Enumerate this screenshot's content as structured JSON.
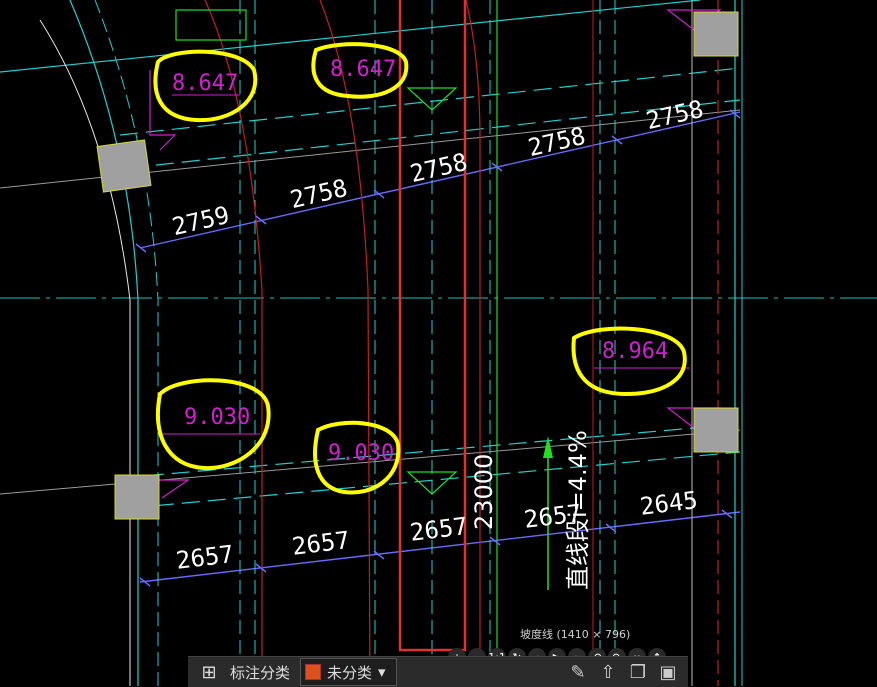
{
  "drawing": {
    "dimensions_top": [
      "2759",
      "2758",
      "2758",
      "2758",
      "2758"
    ],
    "dimensions_bottom": [
      "2657",
      "2657",
      "2657",
      "2657",
      "2645"
    ],
    "elevations": [
      "8.647",
      "8.647",
      "8.964",
      "9.030",
      "9.030"
    ],
    "vertical_label_1": "23000",
    "vertical_label_2": "直线段i=4.4%",
    "colors": {
      "cyan": "#20d0d0",
      "red": "#e03030",
      "blue": "#6a6aff",
      "green": "#20e020",
      "magenta": "#d020d0",
      "highlight": "#ffff00"
    }
  },
  "viewer": {
    "caption": "坡度线 (1410 × 796)",
    "controls": [
      "+",
      "−",
      "1:1",
      "↻",
      "‹",
      "▶",
      "›",
      "↶",
      "↷",
      "↔",
      "↕"
    ]
  },
  "bottom_bar": {
    "label": "标注分类",
    "category": "未分类",
    "tool_icons": [
      "edit-icon",
      "upload-icon",
      "copy-icon",
      "save-icon"
    ]
  }
}
